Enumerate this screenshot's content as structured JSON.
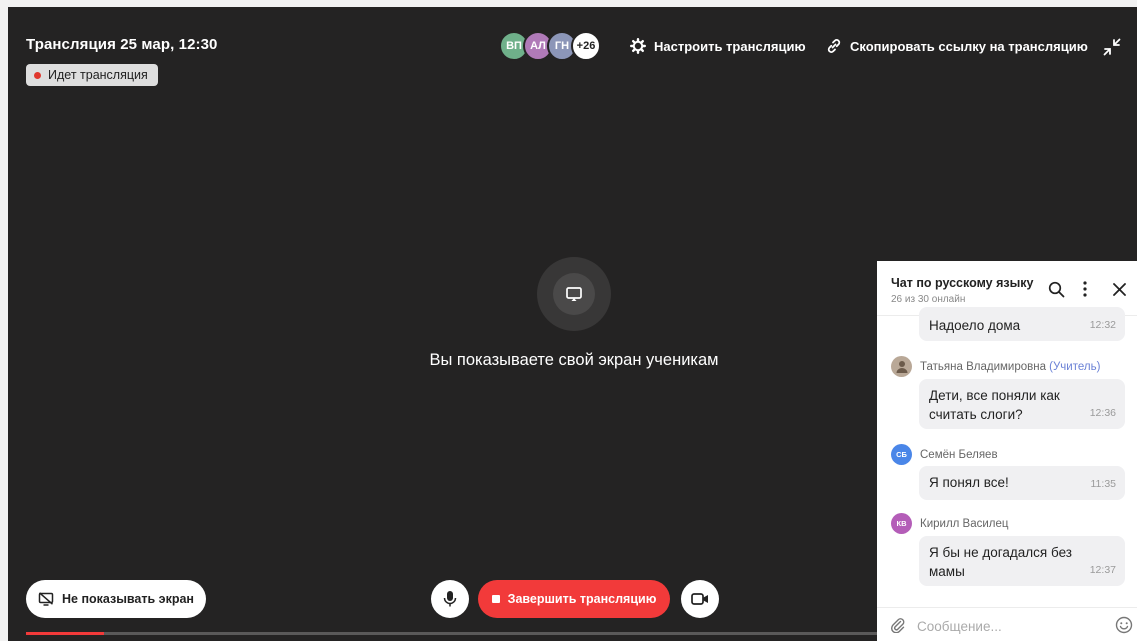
{
  "stream": {
    "title": "Трансляция 25 мар, 12:30",
    "live_label": "Идет трансляция"
  },
  "participants": {
    "avatars": [
      {
        "initials": "ВП",
        "color": "#6fb08a"
      },
      {
        "initials": "АЛ",
        "color": "#b07ab8"
      },
      {
        "initials": "ГН",
        "color": "#8c96b8"
      }
    ],
    "more_count": "+26"
  },
  "actions": {
    "settings_label": "Настроить трансляцию",
    "copy_link_label": "Скопировать ссылку на трансляцию"
  },
  "screen_share": {
    "message": "Вы показываете свой экран ученикам"
  },
  "controls": {
    "stop_sharing_label": "Не показывать экран",
    "end_stream_label": "Завершить трансляцию",
    "progress_fraction": 0.07,
    "accent_color": "#f23a3a"
  },
  "chat": {
    "title": "Чат по русскому языку",
    "online": "26 из 30 онлайн",
    "messages": [
      {
        "text": "Надоело дома",
        "time": "12:32"
      },
      {
        "sender": "Татьяна Владимировна",
        "role": "(Учитель)",
        "text": "Дети, все поняли как считать слоги?",
        "time": "12:36"
      },
      {
        "sender": "Семён Беляев",
        "initials": "СБ",
        "color": "#4a86e8",
        "text": "Я понял все!",
        "time": "11:35"
      },
      {
        "sender": "Кирилл Василец",
        "initials": "КВ",
        "color": "#b45db8",
        "text": "Я бы не догадался без мамы",
        "time": "12:37"
      }
    ],
    "input_placeholder": "Сообщение..."
  }
}
